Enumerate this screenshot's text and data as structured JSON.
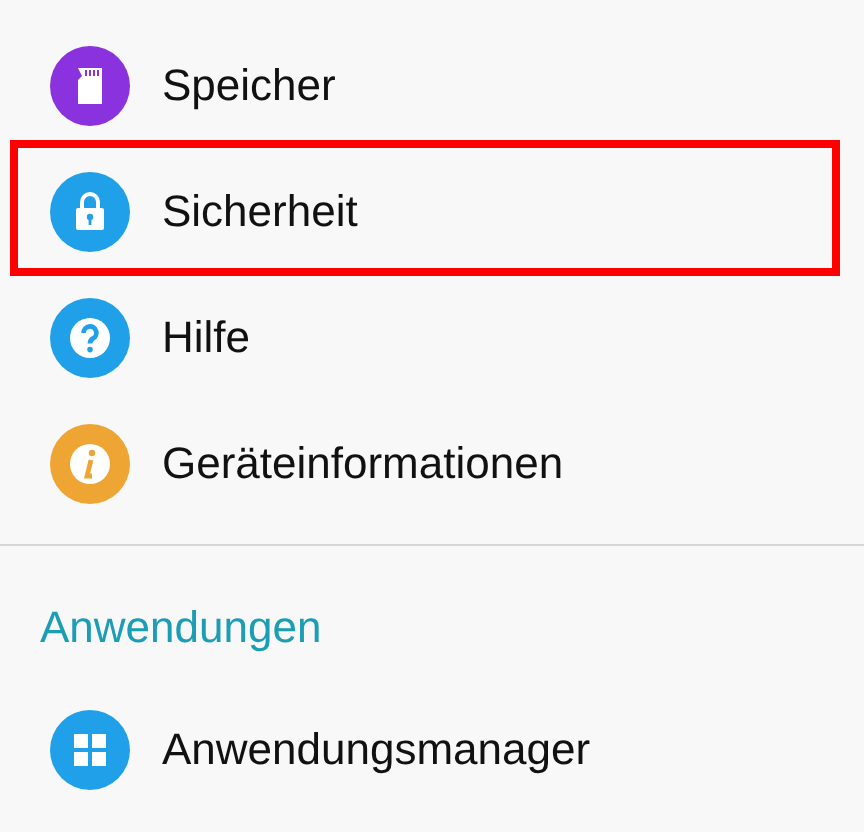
{
  "items_top": [
    {
      "label": "Speicher",
      "kind": "sdcard",
      "color": "#8a32de",
      "highlighted": false
    },
    {
      "label": "Sicherheit",
      "kind": "lock",
      "color": "#21a0ea",
      "highlighted": true
    },
    {
      "label": "Hilfe",
      "kind": "help",
      "color": "#21a0ea",
      "highlighted": false
    },
    {
      "label": "Geräteinformationen",
      "kind": "info",
      "color": "#eea534",
      "highlighted": false
    }
  ],
  "section": {
    "title": "Anwendungen",
    "items": [
      {
        "label": "Anwendungsmanager",
        "kind": "apps",
        "color": "#21a0ea",
        "highlighted": false
      }
    ]
  }
}
